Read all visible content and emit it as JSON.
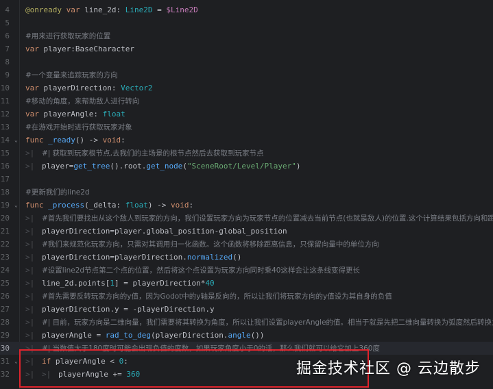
{
  "editor": {
    "lines": [
      {
        "n": "4",
        "fold": "",
        "tokens": [
          [
            "an",
            "@onready"
          ],
          [
            "",
            " "
          ],
          [
            "kw",
            "var"
          ],
          [
            "",
            " line_2d: "
          ],
          [
            "ty",
            "Line2D"
          ],
          [
            "",
            " = "
          ],
          [
            "nd",
            "$Line2D"
          ]
        ]
      },
      {
        "n": "5",
        "fold": "",
        "tokens": []
      },
      {
        "n": "6",
        "fold": "",
        "tokens": [
          [
            "cm",
            "#用来进行获取玩家的位置"
          ]
        ]
      },
      {
        "n": "7",
        "fold": "",
        "tokens": [
          [
            "kw",
            "var"
          ],
          [
            "",
            " player:BaseCharacter"
          ]
        ]
      },
      {
        "n": "8",
        "fold": "",
        "tokens": []
      },
      {
        "n": "9",
        "fold": "",
        "tokens": [
          [
            "cm",
            "#一个变量来追踪玩家的方向"
          ]
        ]
      },
      {
        "n": "10",
        "fold": "",
        "tokens": [
          [
            "kw",
            "var"
          ],
          [
            "",
            " playerDirection: "
          ],
          [
            "ty",
            "Vector2"
          ]
        ]
      },
      {
        "n": "11",
        "fold": "",
        "tokens": [
          [
            "cm",
            "#移动的角度，来帮助敌人进行转向"
          ]
        ]
      },
      {
        "n": "12",
        "fold": "",
        "tokens": [
          [
            "kw",
            "var"
          ],
          [
            "",
            " playerAngle: "
          ],
          [
            "ty",
            "float"
          ]
        ]
      },
      {
        "n": "13",
        "fold": "",
        "tokens": [
          [
            "cm",
            "#在游戏开始时进行获取玩家对象"
          ]
        ]
      },
      {
        "n": "14",
        "fold": "⌄",
        "tokens": [
          [
            "kw",
            "func"
          ],
          [
            "",
            " "
          ],
          [
            "fn",
            "_ready"
          ],
          [
            "",
            "() -> "
          ],
          [
            "kw",
            "void"
          ],
          [
            "",
            ":"
          ]
        ]
      },
      {
        "n": "15",
        "fold": "",
        "tab": 1,
        "tokens": [
          [
            "cm",
            "#| 获取到玩家根节点,去我们的主场景的根节点然后去获取到玩家节点"
          ]
        ]
      },
      {
        "n": "16",
        "fold": "",
        "tab": 1,
        "tokens": [
          [
            "",
            "player="
          ],
          [
            "fn",
            "get_tree"
          ],
          [
            "",
            "().root."
          ],
          [
            "fn",
            "get_node"
          ],
          [
            "",
            "("
          ],
          [
            "str",
            "\"SceneRoot/Level/Player\""
          ],
          [
            "",
            ")"
          ]
        ]
      },
      {
        "n": "17",
        "fold": "",
        "tokens": []
      },
      {
        "n": "18",
        "fold": "",
        "tokens": [
          [
            "cm",
            "#更新我们的line2d"
          ]
        ]
      },
      {
        "n": "19",
        "fold": "⌄",
        "tokens": [
          [
            "kw",
            "func"
          ],
          [
            "",
            " "
          ],
          [
            "fn",
            "_process"
          ],
          [
            "",
            "(_delta: "
          ],
          [
            "ty",
            "float"
          ],
          [
            "",
            ") -> "
          ],
          [
            "kw",
            "void"
          ],
          [
            "",
            ":"
          ]
        ]
      },
      {
        "n": "20",
        "fold": "",
        "tab": 1,
        "tokens": [
          [
            "cm",
            "#首先我们要找出从这个敌人到玩家的方向，我们设置玩家方向为玩家节点的位置减去当前节点(也就是敌人)的位置.这个计算结果包括方向和距离"
          ]
        ]
      },
      {
        "n": "21",
        "fold": "",
        "tab": 1,
        "tokens": [
          [
            "",
            "playerDirection=player.global_position-global_position"
          ]
        ]
      },
      {
        "n": "22",
        "fold": "",
        "tab": 1,
        "tokens": [
          [
            "cm",
            "#我们来规范化玩家方向，只需对其调用归一化函数。这个函数将移除距离信息，只保留向量中的单位方向"
          ]
        ]
      },
      {
        "n": "23",
        "fold": "",
        "tab": 1,
        "tokens": [
          [
            "",
            "playerDirection=playerDirection."
          ],
          [
            "fn",
            "normalized"
          ],
          [
            "",
            "()"
          ]
        ]
      },
      {
        "n": "24",
        "fold": "",
        "tab": 1,
        "tokens": [
          [
            "cm",
            "#设置line2d节点第二个点的位置，然后将这个点设置为玩家方向同时乘40这样会让这条线变得更长"
          ]
        ]
      },
      {
        "n": "25",
        "fold": "",
        "tab": 1,
        "tokens": [
          [
            "",
            "line_2d.points["
          ],
          [
            "num",
            "1"
          ],
          [
            "",
            "] = playerDirection*"
          ],
          [
            "num",
            "40"
          ]
        ]
      },
      {
        "n": "26",
        "fold": "",
        "tab": 1,
        "tokens": [
          [
            "cm",
            "#首先需要反转玩家方向的y值，因为Godot中的y轴是反向的，所以让我们将玩家方向的y值设为其自身的负值"
          ]
        ]
      },
      {
        "n": "27",
        "fold": "",
        "tab": 1,
        "tokens": [
          [
            "",
            "playerDirection.y = -playerDirection.y"
          ]
        ]
      },
      {
        "n": "28",
        "fold": "",
        "tab": 1,
        "tokens": [
          [
            "cm",
            "#| 目前，玩家方向是二维向量，我们需要将其转换为角度，所以让我们设置playerAngle的值。相当于就是先把二维向量转换为弧度然后转换为度数"
          ]
        ]
      },
      {
        "n": "29",
        "fold": "",
        "tab": 1,
        "tokens": [
          [
            "",
            "playerAngle = "
          ],
          [
            "fn",
            "rad_to_deg"
          ],
          [
            "",
            "(playerDirection."
          ],
          [
            "fn",
            "angle"
          ],
          [
            "",
            "())"
          ]
        ]
      },
      {
        "n": "30",
        "fold": "",
        "tab": 1,
        "current": true,
        "tokens": [
          [
            "cm",
            "#| 当数值大于180度时可能会出现负值的度数，如果玩家角度小于0的话，那么我们就可以给它加上360度"
          ]
        ]
      },
      {
        "n": "31",
        "fold": "⌄",
        "tab": 1,
        "tokens": [
          [
            "kw",
            "if"
          ],
          [
            "",
            " playerAngle < "
          ],
          [
            "num",
            "0"
          ],
          [
            "",
            ":"
          ]
        ]
      },
      {
        "n": "32",
        "fold": "",
        "tab": 2,
        "tokens": [
          [
            "",
            "playerAngle += "
          ],
          [
            "num",
            "360"
          ]
        ]
      }
    ]
  },
  "watermark": {
    "text": "掘金技术社区 @ 云边散步"
  },
  "colors": {
    "background": "#1e1f22",
    "highlight_box": "#e0242d",
    "keyword": "#cf8e6d",
    "type": "#2aacb8",
    "function": "#56a8f5",
    "string": "#6aab73"
  }
}
